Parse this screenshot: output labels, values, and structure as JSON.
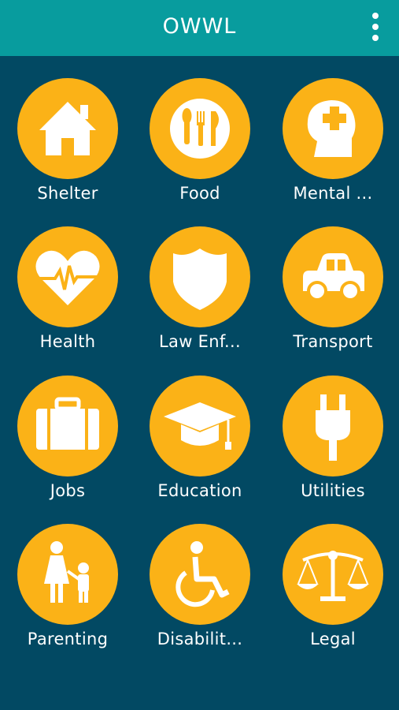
{
  "app": {
    "title": "OWWL"
  },
  "colors": {
    "header": "#089c9e",
    "background": "#024963",
    "icon_circle": "#fbb217",
    "text": "#ffffff"
  },
  "categories": [
    {
      "label": "Shelter",
      "icon": "house-icon"
    },
    {
      "label": "Food",
      "icon": "utensils-icon"
    },
    {
      "label": "Mental ...",
      "icon": "head-medical-icon"
    },
    {
      "label": "Health",
      "icon": "heartbeat-icon"
    },
    {
      "label": "Law Enf...",
      "icon": "shield-icon"
    },
    {
      "label": "Transport",
      "icon": "car-icon"
    },
    {
      "label": "Jobs",
      "icon": "briefcase-icon"
    },
    {
      "label": "Education",
      "icon": "graduation-cap-icon"
    },
    {
      "label": "Utilities",
      "icon": "plug-icon"
    },
    {
      "label": "Parenting",
      "icon": "parent-child-icon"
    },
    {
      "label": "Disabilit...",
      "icon": "wheelchair-icon"
    },
    {
      "label": "Legal",
      "icon": "scales-icon"
    }
  ]
}
